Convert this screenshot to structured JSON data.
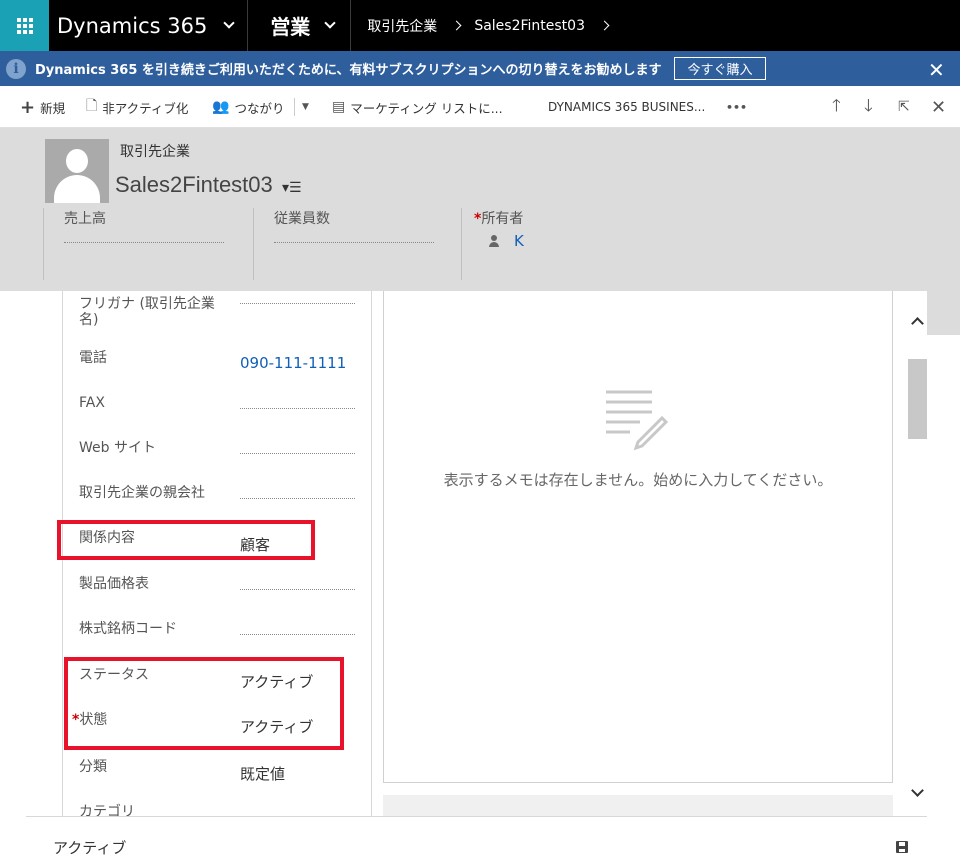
{
  "topnav": {
    "brand": "Dynamics 365",
    "area": "営業",
    "breadcrumb": [
      "取引先企業",
      "Sales2Fintest03"
    ]
  },
  "notification": {
    "text": "Dynamics 365 を引き続きご利用いただくために、有料サブスクリプションへの切り替えをお勧めします",
    "buy_label": "今すぐ購入"
  },
  "commands": {
    "new": "新規",
    "deactivate": "非アクティブ化",
    "connect": "つながり",
    "marketing": "マーケティング リストに...",
    "business": "DYNAMICS 365 BUSINES...",
    "more": "•••"
  },
  "header": {
    "entity_type": "取引先企業",
    "record_name": "Sales2Fintest03",
    "fields": [
      {
        "label": "売上高",
        "value": ""
      },
      {
        "label": "従業員数",
        "value": ""
      },
      {
        "label": "所有者",
        "value": "K",
        "required": true
      }
    ]
  },
  "form": {
    "fields": [
      {
        "label": "フリガナ (取引先企業名)",
        "value": ""
      },
      {
        "label": "電話",
        "value": "090-111-1111",
        "link": true
      },
      {
        "label": "FAX",
        "value": ""
      },
      {
        "label": "Web サイト",
        "value": ""
      },
      {
        "label": "取引先企業の親会社",
        "value": ""
      },
      {
        "label": "関係内容",
        "value": "顧客"
      },
      {
        "label": "製品価格表",
        "value": ""
      },
      {
        "label": "株式銘柄コード",
        "value": ""
      },
      {
        "label": "ステータス",
        "value": "アクティブ"
      },
      {
        "label": "状態",
        "value": "アクティブ",
        "required": true
      },
      {
        "label": "分類",
        "value": "既定値"
      },
      {
        "label": "カテゴリ",
        "value": ""
      }
    ]
  },
  "notes": {
    "empty_text": "表示するメモは存在しません。始めに入力してください。"
  },
  "footer": {
    "status": "アクティブ"
  },
  "colors": {
    "accent": "#1ba1b6",
    "notification_bg": "#2f5e9c",
    "link": "#1160b7",
    "highlight": "#e8132a"
  }
}
